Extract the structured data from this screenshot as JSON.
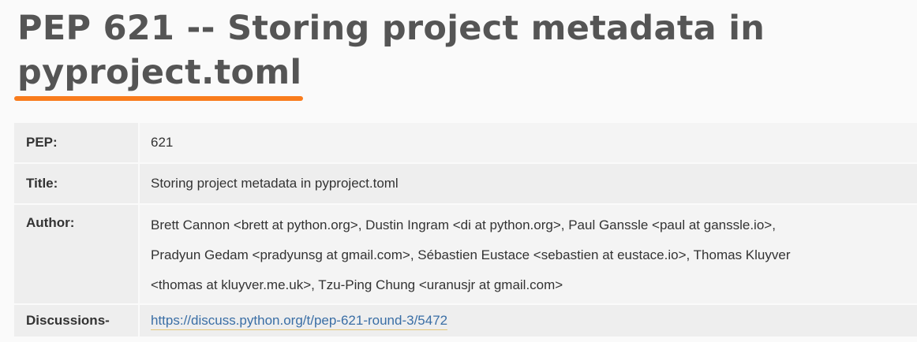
{
  "pep": {
    "title_line1": "PEP 621 -- Storing project metadata in",
    "title_line2": "pyproject.toml",
    "accent_color": "#f97c1d",
    "fields": {
      "pep": {
        "label": "PEP:",
        "value": "621"
      },
      "title": {
        "label": "Title:",
        "value": "Storing project metadata in pyproject.toml"
      },
      "author": {
        "label": "Author:",
        "lines": [
          "Brett Cannon <brett at python.org>, Dustin Ingram <di at python.org>, Paul Ganssle <paul at ganssle.io>,",
          "Pradyun Gedam <pradyunsg at gmail.com>, Sébastien Eustace <sebastien at eustace.io>, Thomas Kluyver",
          "<thomas at kluyver.me.uk>, Tzu-Ping Chung <uranusjr at gmail.com>"
        ]
      },
      "discussions": {
        "label": "Discussions-",
        "link_text": "https://discuss.python.org/t/pep-621-round-3/5472",
        "link_color": "#3a6ea5"
      }
    }
  }
}
